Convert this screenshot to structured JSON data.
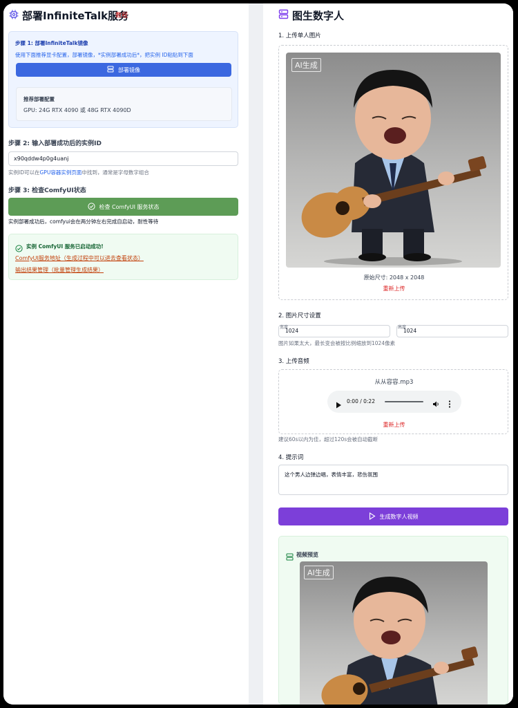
{
  "left": {
    "title": "部署InfiniteTalk服务",
    "tutorial_label": "教程",
    "step1": {
      "title": "步骤 1: 部署InfiniteTalk镜像",
      "description": "使用下面推荐显卡配置，部署镜像，*实例部署成功后*，把实例 ID粘贴到下面",
      "deploy_button": "部署镜像",
      "recommend_title": "推荐部署配置",
      "recommend_value": "GPU: 24G RTX 4090 或 48G RTX 4090D"
    },
    "step2": {
      "title": "步骤 2: 输入部署成功后的实例ID",
      "input_value": "x90qddw4p0g4uanj",
      "hint_prefix": "实例ID可以在",
      "hint_link": "GPU容器实例页面",
      "hint_suffix": "中找到，通常是字母数字组合"
    },
    "step3": {
      "title": "步骤 3: 检查ComfyUI状态",
      "check_button": "检查 ComfyUI 服务状态",
      "note": "实例部署成功后，comfyui会在两分钟左右完成自启动，耐性等待",
      "success_text": "实例 ComfyUI 服务已启动成功!",
      "link1": "ComfyUI服务地址（生成过程中可以进去查看状态）",
      "link2": "输出结果管理（批量管理生成结果）"
    }
  },
  "right": {
    "title": "图生数字人",
    "upload_image_label": "1. 上传单人图片",
    "ai_tag": "AI生成",
    "original_size": "原始尺寸: 2048 x 2048",
    "reupload": "重新上传",
    "size_settings_label": "2. 图片尺寸设置",
    "width_label": "宽度",
    "width_value": "1024",
    "height_label": "高度",
    "height_value": "1024",
    "size_hint": "图片如果太大，最长变会被按比例缩放到1024像素",
    "upload_audio_label": "3. 上传音频",
    "audio_filename": "从从容容.mp3",
    "audio_time": "0:00 / 0:22",
    "audio_reupload": "重新上传",
    "audio_hint": "建议60s以内为佳，超过120s会被自动截断",
    "prompt_label": "4. 提示词",
    "prompt_value": "这个男人边弹边唱，表情丰富，悲伤氛围",
    "generate_button": "生成数字人视频",
    "preview_label": "视频预览",
    "preview_ai_tag": "AI生成"
  }
}
